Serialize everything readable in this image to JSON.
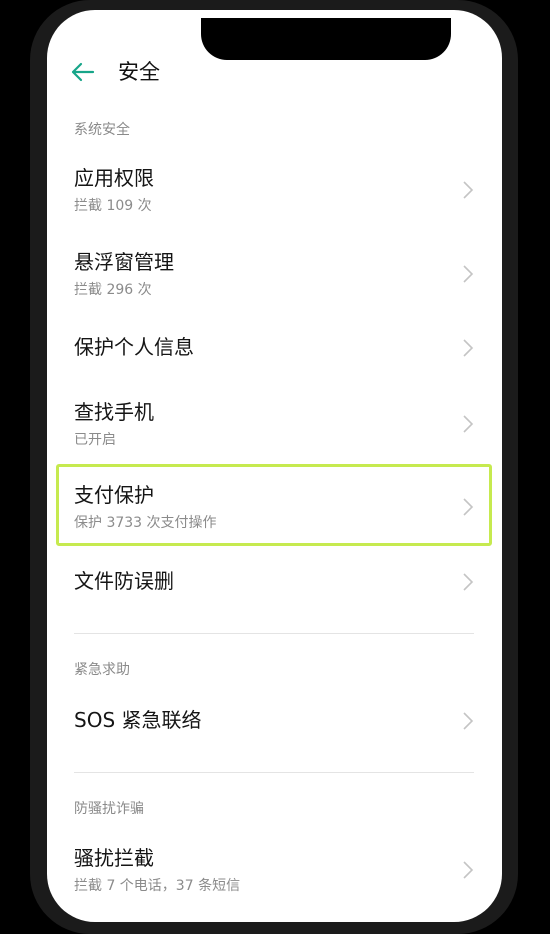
{
  "colors": {
    "accent": "#17a589",
    "highlight": "#c6ea4f",
    "text_primary": "#151515",
    "text_secondary": "#8b8b8b"
  },
  "header": {
    "title": "安全",
    "back_icon": "arrow-left-icon"
  },
  "sections": {
    "system": "系统安全",
    "emergency": "紧急求助",
    "anti_fraud": "防骚扰诈骗"
  },
  "items": [
    {
      "title": "应用权限",
      "subtitle": "拦截 109 次"
    },
    {
      "title": "悬浮窗管理",
      "subtitle": "拦截 296 次"
    },
    {
      "title": "保护个人信息",
      "subtitle": ""
    },
    {
      "title": "查找手机",
      "subtitle": "已开启"
    },
    {
      "title": "支付保护",
      "subtitle": "保护 3733 次支付操作"
    },
    {
      "title": "文件防误删",
      "subtitle": ""
    },
    {
      "title": "SOS 紧急联络",
      "subtitle": ""
    },
    {
      "title": "骚扰拦截",
      "subtitle": "拦截 7 个电话，37 条短信"
    }
  ]
}
